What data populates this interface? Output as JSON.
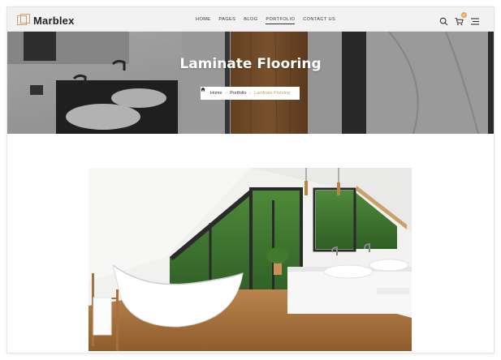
{
  "brand": {
    "name": "Marblex"
  },
  "nav": {
    "items": [
      {
        "label": "HOME"
      },
      {
        "label": "PAGES"
      },
      {
        "label": "BLOG"
      },
      {
        "label": "PORTFOLIO",
        "active": true
      },
      {
        "label": "CONTACT US"
      }
    ]
  },
  "header_icons": {
    "search": "search-icon",
    "cart": "cart-icon",
    "cart_count": "0",
    "menu": "hamburger-menu-icon"
  },
  "hero": {
    "title": "Laminate Flooring",
    "breadcrumb": {
      "home": "Home",
      "parent": "Portfolio",
      "current": "Laminate Flooring",
      "separator": "›"
    }
  },
  "colors": {
    "accent": "#c9a06a",
    "cart_badge": "#e8a45b",
    "header_bg": "#f2f2f2"
  }
}
